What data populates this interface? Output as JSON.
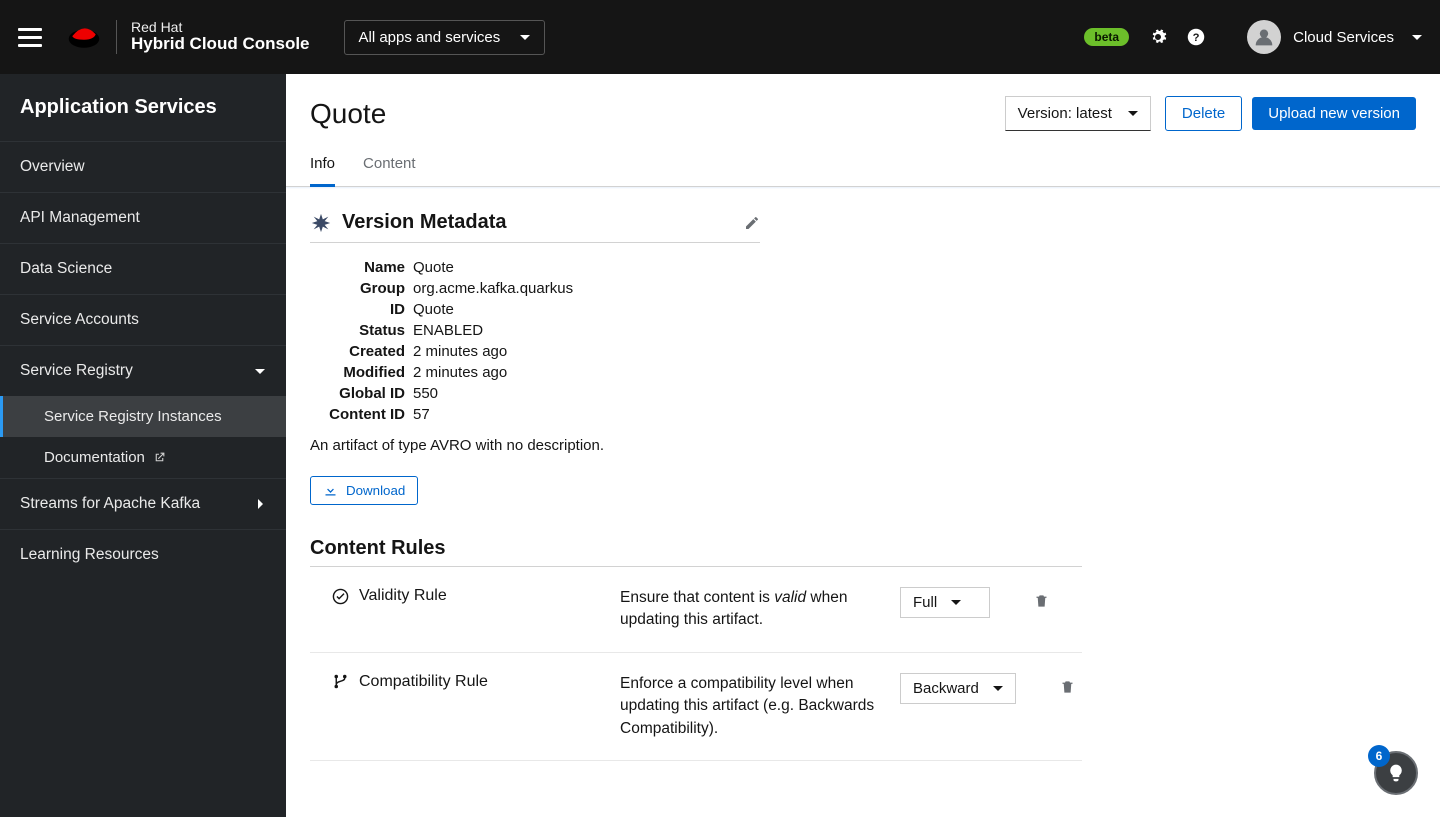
{
  "header": {
    "brand_line1": "Red Hat",
    "brand_line2": "Hybrid Cloud Console",
    "apps_dropdown": "All apps and services",
    "beta_label": "beta",
    "user_label": "Cloud Services"
  },
  "sidebar": {
    "title": "Application Services",
    "items": [
      {
        "label": "Overview"
      },
      {
        "label": "API Management"
      },
      {
        "label": "Data Science"
      },
      {
        "label": "Service Accounts"
      },
      {
        "label": "Service Registry",
        "expandable": true,
        "expanded": true
      },
      {
        "label": "Streams for Apache Kafka",
        "expandable": true,
        "expanded": false
      },
      {
        "label": "Learning Resources"
      }
    ],
    "registry_children": [
      {
        "label": "Service Registry Instances",
        "current": true
      },
      {
        "label": "Documentation",
        "external": true
      }
    ]
  },
  "page": {
    "title": "Quote",
    "version_selector": "Version: latest",
    "delete_btn": "Delete",
    "upload_btn": "Upload new version",
    "tabs": {
      "info": "Info",
      "content": "Content"
    }
  },
  "metadata": {
    "section_title": "Version Metadata",
    "rows": {
      "Name": "Quote",
      "Group": "org.acme.kafka.quarkus",
      "ID": "Quote",
      "Status": "ENABLED",
      "Created": "2 minutes ago",
      "Modified": "2 minutes ago",
      "Global ID": "550",
      "Content ID": "57"
    },
    "description": "An artifact of type AVRO with no description.",
    "download_label": "Download"
  },
  "rules": {
    "section_title": "Content Rules",
    "validity": {
      "name": "Validity Rule",
      "desc_pre": "Ensure that content is ",
      "desc_em": "valid",
      "desc_post": " when updating this artifact.",
      "value": "Full"
    },
    "compatibility": {
      "name": "Compatibility Rule",
      "desc": "Enforce a compatibility level when updating this artifact (e.g. Backwards Compatibility).",
      "value": "Backward"
    }
  },
  "beacon": {
    "count": "6"
  }
}
